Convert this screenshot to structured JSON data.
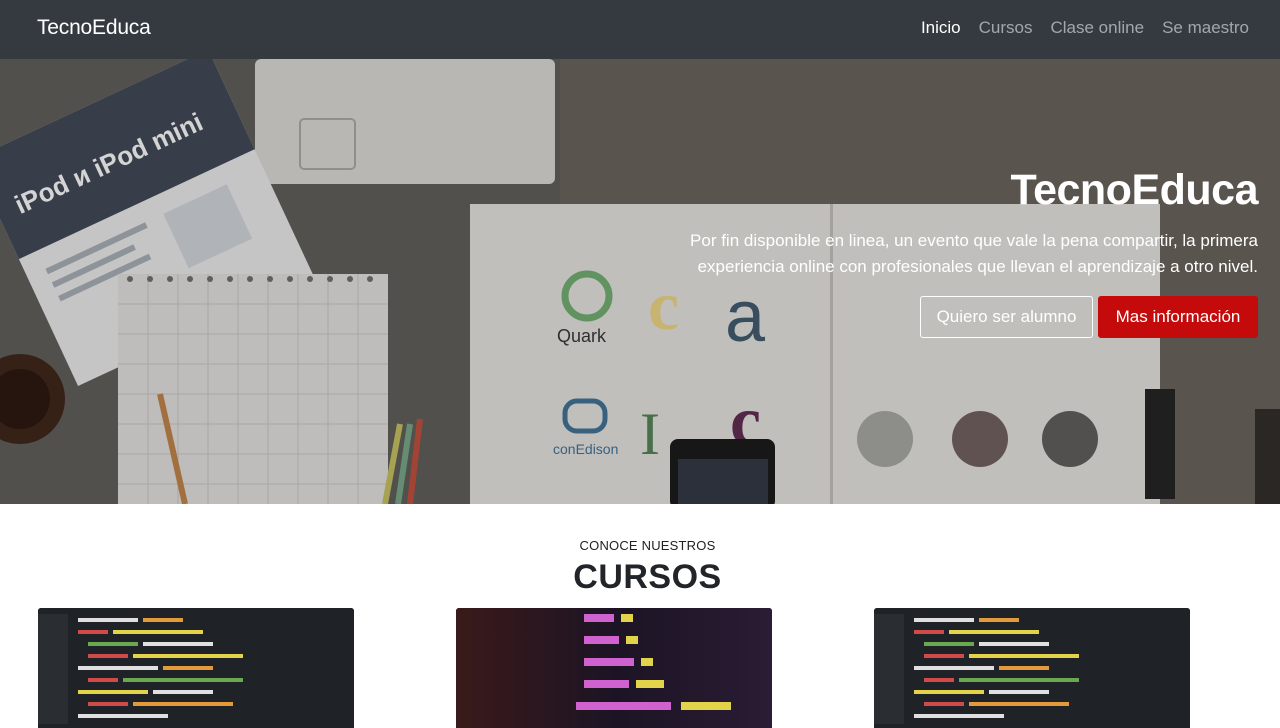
{
  "navbar": {
    "brand": "TecnoEduca",
    "items": [
      {
        "label": "Inicio",
        "active": true
      },
      {
        "label": "Cursos",
        "active": false
      },
      {
        "label": "Clase online",
        "active": false
      },
      {
        "label": "Se maestro",
        "active": false
      }
    ]
  },
  "hero": {
    "title": "TecnoEduca",
    "text": "Por fin disponible en linea, un evento que vale la pena compartir, la primera experiencia online con profesionales que llevan el aprendizaje a otro nivel.",
    "btn_student": "Quiero ser alumno",
    "btn_info": "Mas información",
    "image_labels": {
      "booklet": "iPod и iPod mini",
      "logo1": "Quark",
      "logo2": "conEdison"
    }
  },
  "courses_section": {
    "kicker": "CONOCE NUESTROS",
    "title": "CURSOS"
  },
  "colors": {
    "navbar_bg": "#343a40",
    "accent_red": "#c40a0a"
  }
}
